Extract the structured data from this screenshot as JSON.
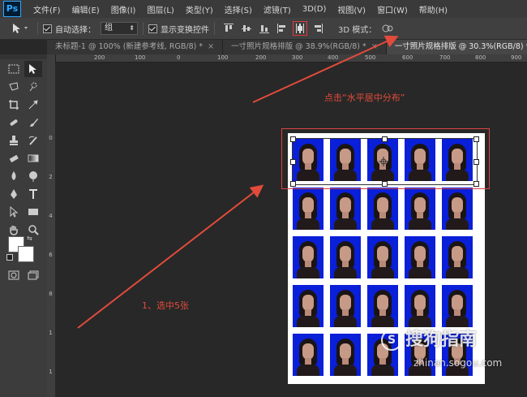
{
  "app": {
    "logo": "Ps"
  },
  "menu": [
    "文件(F)",
    "编辑(E)",
    "图像(I)",
    "图层(L)",
    "类型(Y)",
    "选择(S)",
    "滤镜(T)",
    "3D(D)",
    "视图(V)",
    "窗口(W)",
    "帮助(H)"
  ],
  "options": {
    "auto_select_label": "自动选择：",
    "auto_select_value": "组",
    "show_transform_label": "显示变换控件",
    "mode_3d_label": "3D 模式："
  },
  "tabs": [
    {
      "label": "未标题-1 @ 100% (新建参考线, RGB/8) *",
      "close": "×"
    },
    {
      "label": "一寸照片规格排版 @ 38.9%(RGB/8) *",
      "close": "×"
    },
    {
      "label": "一寸照片规格排版 @ 30.3%(RGB/8) *",
      "close": "×"
    }
  ],
  "ruler_top": [
    "200",
    "100",
    "0",
    "100",
    "200",
    "300",
    "400",
    "500",
    "600",
    "700",
    "800",
    "900"
  ],
  "ruler_left": [
    "0",
    "2",
    "4",
    "6",
    "8",
    "1",
    "1"
  ],
  "annotations": {
    "distribute": "点击“水平居中分布”",
    "select5": "1、选中5张"
  },
  "watermark": {
    "brand": "搜狗指南",
    "url": "zhinan.sogou.com"
  },
  "colors": {
    "annotation": "#e24b3b",
    "photo_bg": "#0a1fd8",
    "highlight": "#d94444"
  }
}
